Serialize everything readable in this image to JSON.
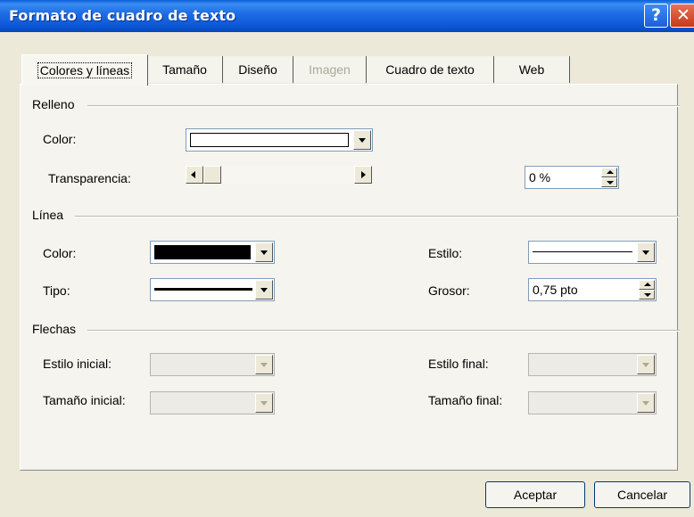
{
  "window": {
    "title": "Formato de cuadro de texto"
  },
  "tabs": [
    "Colores y líneas",
    "Tamaño",
    "Diseño",
    "Imagen",
    "Cuadro de texto",
    "Web"
  ],
  "relleno": {
    "heading": "Relleno",
    "color_label": "Color:",
    "transparency_label": "Transparencia:",
    "transparency_value": "0 %",
    "fill_color": "#ffffff"
  },
  "linea": {
    "heading": "Línea",
    "color_label": "Color:",
    "type_label": "Tipo:",
    "style_label": "Estilo:",
    "weight_label": "Grosor:",
    "weight_value": "0,75 pto",
    "line_color": "#000000"
  },
  "flechas": {
    "heading": "Flechas",
    "start_style_label": "Estilo inicial:",
    "start_size_label": "Tamaño inicial:",
    "end_style_label": "Estilo final:",
    "end_size_label": "Tamaño final:"
  },
  "buttons": {
    "ok": "Aceptar",
    "cancel": "Cancelar"
  },
  "icons": {
    "help": "help-icon",
    "close": "close-icon"
  }
}
